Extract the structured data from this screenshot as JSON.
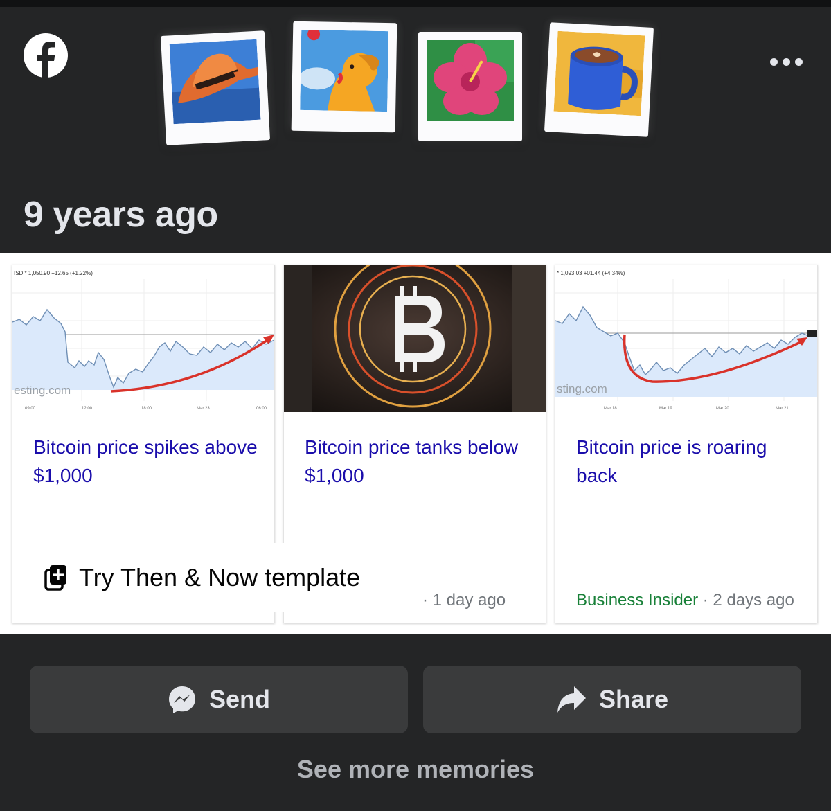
{
  "header": {
    "app_icon": "facebook-logo-icon",
    "illustrations": [
      "cowboy-hat",
      "dog-with-ball",
      "hibiscus-flower",
      "coffee-mug"
    ],
    "more_icon": "more-horizontal-icon"
  },
  "memory": {
    "time_label": "9 years ago",
    "articles": [
      {
        "title": "Bitcoin price spikes above $1,000",
        "thumbnail": "price-chart",
        "chart_header": "ISD * 1,050.90 +12.65 (+1.22%)",
        "chart_watermark": "esting.com",
        "axis_labels": [
          "09:00",
          "12:00",
          "18:00",
          "Mar 23",
          "06:00"
        ]
      },
      {
        "title": "Bitcoin price tanks below $1,000",
        "thumbnail": "bitcoin-symbol-photo",
        "meta_time": "· 1 day ago"
      },
      {
        "title": "Bitcoin price is roaring back",
        "thumbnail": "price-chart",
        "chart_header": "* 1,093.03 +01.44 (+4.34%)",
        "chart_watermark": "sting.com",
        "axis_labels": [
          "Mar 18",
          "Mar 19",
          "Mar 20",
          "Mar 21"
        ],
        "source": "Business Insider",
        "meta_time": " · 2 days ago"
      }
    ],
    "template_prompt": "Try Then & Now template"
  },
  "actions": {
    "send_label": "Send",
    "share_label": "Share",
    "see_more_label": "See more memories"
  },
  "colors": {
    "background": "#242526",
    "button": "#3a3b3c",
    "text_primary": "#e4e6eb",
    "text_secondary": "#b0b3b8",
    "link_blue": "#1a0dab",
    "source_green": "#188038"
  }
}
